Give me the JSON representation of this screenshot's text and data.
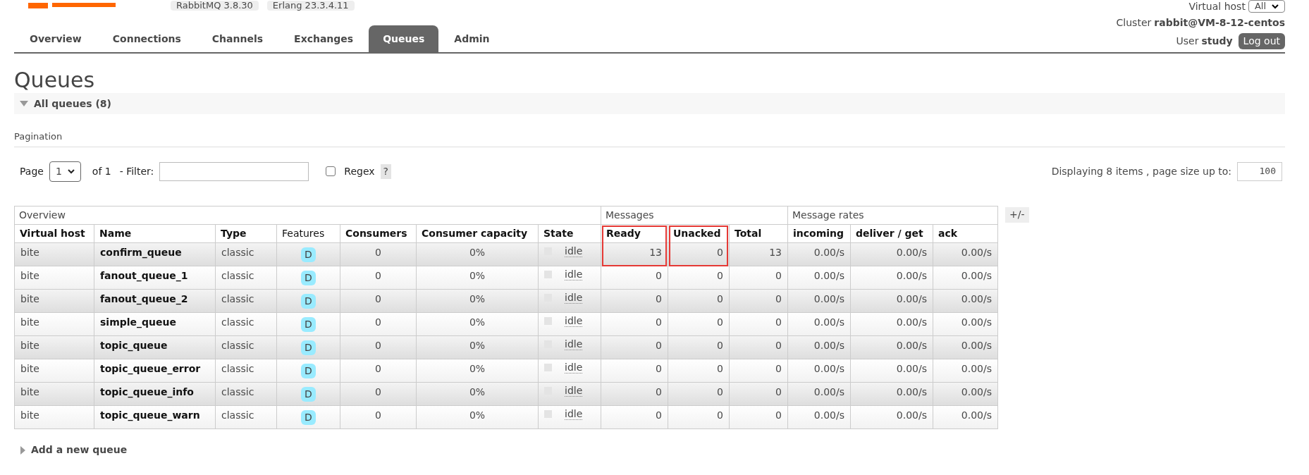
{
  "header": {
    "version_badges": [
      "RabbitMQ 3.8.30",
      "Erlang 23.3.4.11"
    ],
    "virtual_host": {
      "label": "Virtual host",
      "value": "All"
    },
    "cluster": {
      "label": "Cluster",
      "value": "rabbit@VM-8-12-centos"
    },
    "user": {
      "label": "User",
      "value": "study"
    },
    "logout_button": "Log out"
  },
  "tabs": [
    {
      "label": "Overview",
      "selected": false
    },
    {
      "label": "Connections",
      "selected": false
    },
    {
      "label": "Channels",
      "selected": false
    },
    {
      "label": "Exchanges",
      "selected": false
    },
    {
      "label": "Queues",
      "selected": true
    },
    {
      "label": "Admin",
      "selected": false
    }
  ],
  "page_title": "Queues",
  "all_queues": {
    "label": "All queues (8)",
    "expanded": true
  },
  "pagination": {
    "title": "Pagination",
    "page_label": "Page",
    "page_value": "1",
    "of_label": "of 1",
    "filter_label": "- Filter:",
    "regex": {
      "label": "Regex",
      "checked": false
    },
    "help": "?",
    "display_text": "Displaying 8 items , page size up to:",
    "page_size": "100"
  },
  "table": {
    "groups": [
      {
        "label": "Overview",
        "columns": [
          {
            "label": "Virtual host",
            "kind": "text",
            "highlighted": false
          },
          {
            "label": "Name",
            "kind": "name",
            "highlighted": false
          },
          {
            "label": "Type",
            "kind": "text",
            "highlighted": false
          },
          {
            "label": "Features",
            "kind": "feature",
            "highlighted": false
          },
          {
            "label": "Consumers",
            "kind": "center",
            "highlighted": false
          },
          {
            "label": "Consumer capacity",
            "kind": "center",
            "highlighted": false
          },
          {
            "label": "State",
            "kind": "state",
            "highlighted": false
          }
        ]
      },
      {
        "label": "Messages",
        "columns": [
          {
            "label": "Ready",
            "kind": "number",
            "highlighted": true
          },
          {
            "label": "Unacked",
            "kind": "number",
            "highlighted": true
          },
          {
            "label": "Total",
            "kind": "number",
            "highlighted": false
          }
        ]
      },
      {
        "label": "Message rates",
        "columns": [
          {
            "label": "incoming",
            "kind": "number",
            "highlighted": false
          },
          {
            "label": "deliver / get",
            "kind": "number",
            "highlighted": false
          },
          {
            "label": "ack",
            "kind": "number",
            "highlighted": false
          }
        ]
      }
    ],
    "toggle": "+/-",
    "rows": [
      {
        "cells": [
          "bite",
          "confirm_queue",
          "classic",
          "D",
          "0",
          "0%",
          "idle",
          "13",
          "0",
          "13",
          "0.00/s",
          "0.00/s",
          "0.00/s"
        ]
      },
      {
        "cells": [
          "bite",
          "fanout_queue_1",
          "classic",
          "D",
          "0",
          "0%",
          "idle",
          "0",
          "0",
          "0",
          "0.00/s",
          "0.00/s",
          "0.00/s"
        ]
      },
      {
        "cells": [
          "bite",
          "fanout_queue_2",
          "classic",
          "D",
          "0",
          "0%",
          "idle",
          "0",
          "0",
          "0",
          "0.00/s",
          "0.00/s",
          "0.00/s"
        ]
      },
      {
        "cells": [
          "bite",
          "simple_queue",
          "classic",
          "D",
          "0",
          "0%",
          "idle",
          "0",
          "0",
          "0",
          "0.00/s",
          "0.00/s",
          "0.00/s"
        ]
      },
      {
        "cells": [
          "bite",
          "topic_queue",
          "classic",
          "D",
          "0",
          "0%",
          "idle",
          "0",
          "0",
          "0",
          "0.00/s",
          "0.00/s",
          "0.00/s"
        ]
      },
      {
        "cells": [
          "bite",
          "topic_queue_error",
          "classic",
          "D",
          "0",
          "0%",
          "idle",
          "0",
          "0",
          "0",
          "0.00/s",
          "0.00/s",
          "0.00/s"
        ]
      },
      {
        "cells": [
          "bite",
          "topic_queue_info",
          "classic",
          "D",
          "0",
          "0%",
          "idle",
          "0",
          "0",
          "0",
          "0.00/s",
          "0.00/s",
          "0.00/s"
        ]
      },
      {
        "cells": [
          "bite",
          "topic_queue_warn",
          "classic",
          "D",
          "0",
          "0%",
          "idle",
          "0",
          "0",
          "0",
          "0.00/s",
          "0.00/s",
          "0.00/s"
        ]
      }
    ]
  },
  "add_queue": {
    "label": "Add a new queue",
    "expanded": false
  }
}
